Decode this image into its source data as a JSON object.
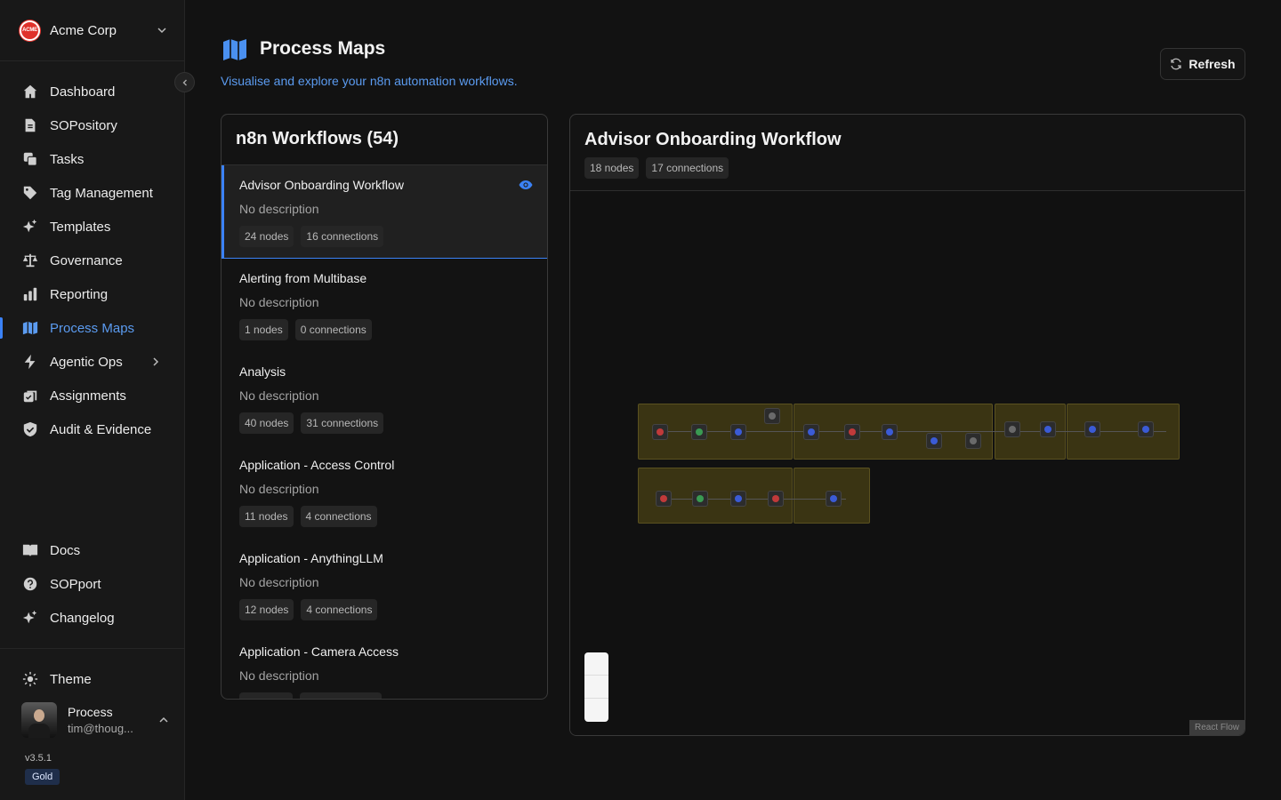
{
  "org": {
    "name": "Acme Corp",
    "logo_text": "ACME"
  },
  "nav": {
    "items": [
      {
        "label": "Dashboard",
        "icon": "home-icon"
      },
      {
        "label": "SOPository",
        "icon": "document-icon"
      },
      {
        "label": "Tasks",
        "icon": "tasks-icon"
      },
      {
        "label": "Tag Management",
        "icon": "tag-icon"
      },
      {
        "label": "Templates",
        "icon": "sparkles-icon"
      },
      {
        "label": "Governance",
        "icon": "scale-icon"
      },
      {
        "label": "Reporting",
        "icon": "bar-chart-icon"
      },
      {
        "label": "Process Maps",
        "icon": "map-icon",
        "active": true
      },
      {
        "label": "Agentic Ops",
        "icon": "lightning-icon"
      },
      {
        "label": "Assignments",
        "icon": "assignment-icon"
      },
      {
        "label": "Audit & Evidence",
        "icon": "shield-icon"
      }
    ],
    "footer_items": [
      {
        "label": "Docs",
        "icon": "book-icon"
      },
      {
        "label": "SOPport",
        "icon": "help-icon"
      },
      {
        "label": "Changelog",
        "icon": "sparkles-icon"
      }
    ],
    "theme_label": "Theme"
  },
  "user": {
    "name": "Process",
    "email": "tim@thoug..."
  },
  "version": "v3.5.1",
  "plan": "Gold",
  "page": {
    "title": "Process Maps",
    "subtitle": "Visualise and explore your n8n automation workflows.",
    "refresh_label": "Refresh"
  },
  "workflows": {
    "title": "n8n Workflows (54)",
    "items": [
      {
        "name": "Advisor Onboarding Workflow",
        "description": "No description",
        "nodes": "24 nodes",
        "connections": "16 connections",
        "selected": true
      },
      {
        "name": "Alerting from Multibase",
        "description": "No description",
        "nodes": "1 nodes",
        "connections": "0 connections"
      },
      {
        "name": "Analysis",
        "description": "No description",
        "nodes": "40 nodes",
        "connections": "31 connections"
      },
      {
        "name": "Application - Access Control",
        "description": "No description",
        "nodes": "11 nodes",
        "connections": "4 connections"
      },
      {
        "name": "Application - AnythingLLM",
        "description": "No description",
        "nodes": "12 nodes",
        "connections": "4 connections"
      },
      {
        "name": "Application - Camera Access",
        "description": "No description",
        "nodes": "",
        "connections": ""
      }
    ]
  },
  "canvas": {
    "title": "Advisor Onboarding Workflow",
    "nodes": "18 nodes",
    "connections": "17 connections",
    "attribution": "React Flow"
  }
}
